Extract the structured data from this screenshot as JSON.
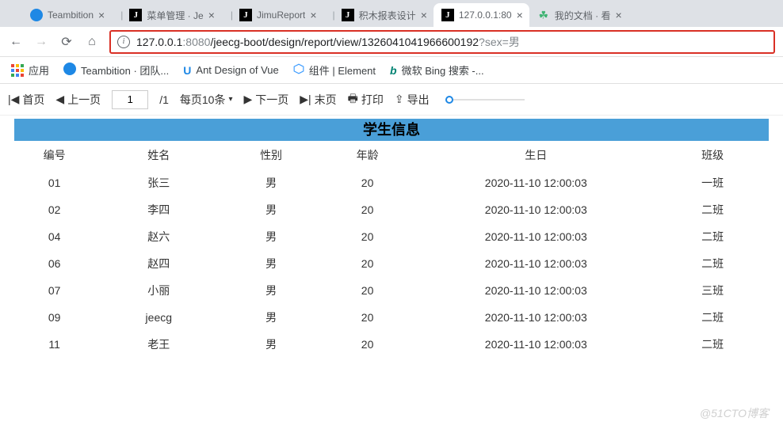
{
  "tabs": [
    {
      "label": "Teambition",
      "icon": "teambition"
    },
    {
      "label": "菜单管理 · Je",
      "icon": "j"
    },
    {
      "label": "JimuReport",
      "icon": "j"
    },
    {
      "label": "积木报表设计",
      "icon": "j"
    },
    {
      "label": "127.0.0.1:80",
      "icon": "j",
      "active": true
    },
    {
      "label": "我的文档 · 看",
      "icon": "doc"
    }
  ],
  "url": {
    "host": "127.0.0.1",
    "port": ":8080",
    "path": "/jeecg-boot/design/report/view/1326041041966600192",
    "query": "?sex=男"
  },
  "bookmarks": {
    "apps": "应用",
    "items": [
      {
        "label": "Teambition · 团队...",
        "icon": "teambition"
      },
      {
        "label": "Ant Design of Vue",
        "icon": "v"
      },
      {
        "label": "组件 | Element",
        "icon": "hex"
      },
      {
        "label": "微软 Bing 搜索 -...",
        "icon": "b"
      }
    ]
  },
  "toolbar": {
    "first": "首页",
    "prev": "上一页",
    "page_current": "1",
    "page_total": "/1",
    "per_page": "每页10条",
    "next": "下一页",
    "last": "末页",
    "print": "打印",
    "export": "导出"
  },
  "report": {
    "title": "学生信息",
    "headers": {
      "id": "编号",
      "name": "姓名",
      "sex": "性别",
      "age": "年龄",
      "birthday": "生日",
      "class": "班级"
    },
    "rows": [
      {
        "id": "01",
        "name": "张三",
        "sex": "男",
        "age": "20",
        "birthday": "2020-11-10 12:00:03",
        "class": "一班"
      },
      {
        "id": "02",
        "name": "李四",
        "sex": "男",
        "age": "20",
        "birthday": "2020-11-10 12:00:03",
        "class": "二班"
      },
      {
        "id": "04",
        "name": "赵六",
        "sex": "男",
        "age": "20",
        "birthday": "2020-11-10 12:00:03",
        "class": "二班"
      },
      {
        "id": "06",
        "name": "赵四",
        "sex": "男",
        "age": "20",
        "birthday": "2020-11-10 12:00:03",
        "class": "二班"
      },
      {
        "id": "07",
        "name": "小丽",
        "sex": "男",
        "age": "20",
        "birthday": "2020-11-10 12:00:03",
        "class": "三班"
      },
      {
        "id": "09",
        "name": "jeecg",
        "sex": "男",
        "age": "20",
        "birthday": "2020-11-10 12:00:03",
        "class": "二班"
      },
      {
        "id": "11",
        "name": "老王",
        "sex": "男",
        "age": "20",
        "birthday": "2020-11-10 12:00:03",
        "class": "二班"
      }
    ]
  },
  "watermark": "@51CTO博客"
}
